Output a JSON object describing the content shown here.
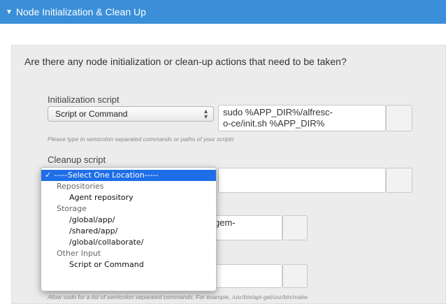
{
  "section": {
    "title": "Node Initialization & Clean Up"
  },
  "question": "Are there any node initialization or clean-up actions that need to be taken?",
  "init": {
    "label": "Initialization script",
    "type_value": "Script or Command",
    "command_line1": "sudo %APP_DIR%/alfresc-",
    "command_line2": "o-ce/init.sh %APP_DIR%",
    "hint": "Please type in semicolon separated commands or paths of your scripts"
  },
  "cleanup": {
    "label": "Cleanup script"
  },
  "partial": {
    "text1": "gem-",
    "hint": "Allow sudo for a list of semicolon separated commands. For example, /usr/bin/apt-get/usr/bin/make."
  },
  "dropdown": {
    "check": "✓",
    "selected": "-----Select One Location-----",
    "groups": [
      {
        "label": "Repositories",
        "items": [
          "Agent repository"
        ]
      },
      {
        "label": "Storage",
        "items": [
          "/global/app/",
          "/shared/app/",
          "/global/collaborate/"
        ]
      },
      {
        "label": "Other Input",
        "items": [
          "Script or Command"
        ]
      }
    ]
  }
}
